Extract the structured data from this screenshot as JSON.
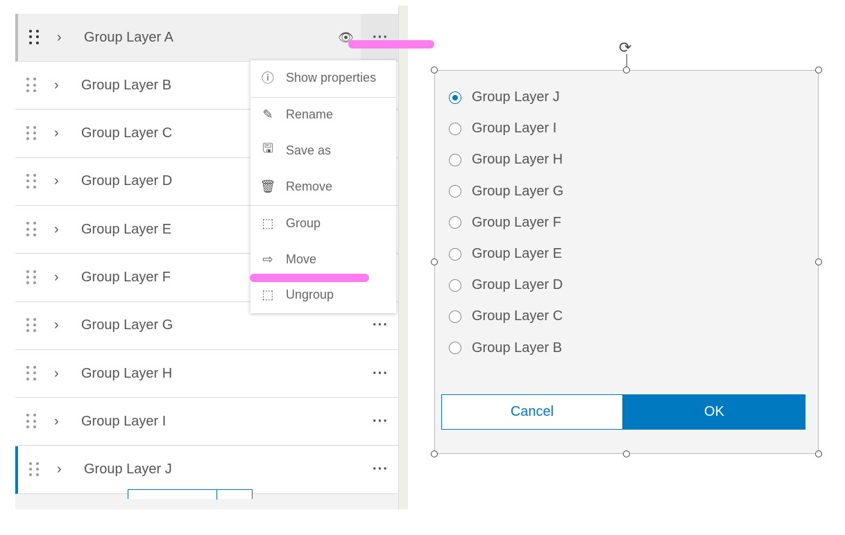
{
  "layers": [
    {
      "label": "Group Layer A"
    },
    {
      "label": "Group Layer B"
    },
    {
      "label": "Group Layer C"
    },
    {
      "label": "Group Layer D"
    },
    {
      "label": "Group Layer E"
    },
    {
      "label": "Group Layer F"
    },
    {
      "label": "Group Layer G"
    },
    {
      "label": "Group Layer H"
    },
    {
      "label": "Group Layer I"
    },
    {
      "label": "Group Layer J"
    }
  ],
  "menu": {
    "show_properties": "Show properties",
    "rename": "Rename",
    "save_as": "Save as",
    "remove": "Remove",
    "group": "Group",
    "move": "Move",
    "ungroup": "Ungroup"
  },
  "dialog": {
    "options": [
      "Group Layer J",
      "Group Layer I",
      "Group Layer H",
      "Group Layer G",
      "Group Layer F",
      "Group Layer E",
      "Group Layer D",
      "Group Layer C",
      "Group Layer B"
    ],
    "selected": "Group Layer J",
    "cancel": "Cancel",
    "ok": "OK"
  },
  "colors": {
    "accent": "#0079c1",
    "highlight": "#ff7cf0"
  }
}
